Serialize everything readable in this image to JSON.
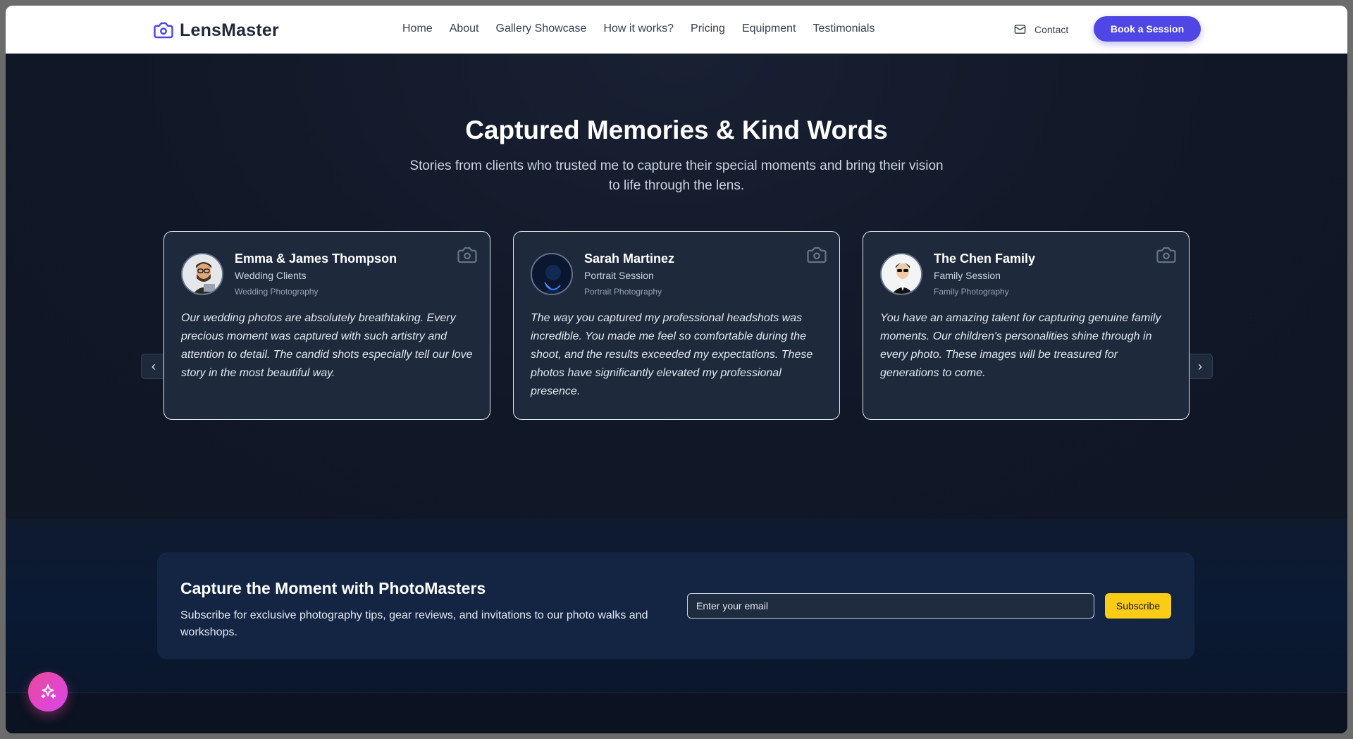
{
  "nav": {
    "brand": "LensMaster",
    "items": [
      "Home",
      "About",
      "Gallery Showcase",
      "How it works?",
      "Pricing",
      "Equipment",
      "Testimonials"
    ],
    "contact": "Contact",
    "book": "Book a Session"
  },
  "testimonials": {
    "heading": "Captured Memories & Kind Words",
    "subheading": "Stories from clients who trusted me to capture their special moments and bring their vision to life through the lens.",
    "cards": [
      {
        "name": "Emma & James Thompson",
        "role": "Wedding Clients",
        "type": "Wedding Photography",
        "quote": "Our wedding photos are absolutely breathtaking. Every precious moment was captured with such artistry and attention to detail. The candid shots especially tell our love story in the most beautiful way."
      },
      {
        "name": "Sarah Martinez",
        "role": "Portrait Session",
        "type": "Portrait Photography",
        "quote": "The way you captured my professional headshots was incredible. You made me feel so comfortable during the shoot, and the results exceeded my expectations. These photos have significantly elevated my professional presence."
      },
      {
        "name": "The Chen Family",
        "role": "Family Session",
        "type": "Family Photography",
        "quote": "You have an amazing talent for capturing genuine family moments. Our children's personalities shine through in every photo. These images will be treasured for generations to come."
      }
    ]
  },
  "newsletter": {
    "title": "Capture the Moment with PhotoMasters",
    "description": "Subscribe for exclusive photography tips, gear reviews, and invitations to our photo walks and workshops.",
    "placeholder": "Enter your email",
    "button": "Subscribe"
  },
  "colors": {
    "accent": "#4f46e5",
    "subscribe": "#facc15",
    "fab": "#ec4899"
  },
  "icons": [
    "camera-icon",
    "mail-icon",
    "chevron-left-icon",
    "chevron-right-icon",
    "sparkles-icon"
  ]
}
